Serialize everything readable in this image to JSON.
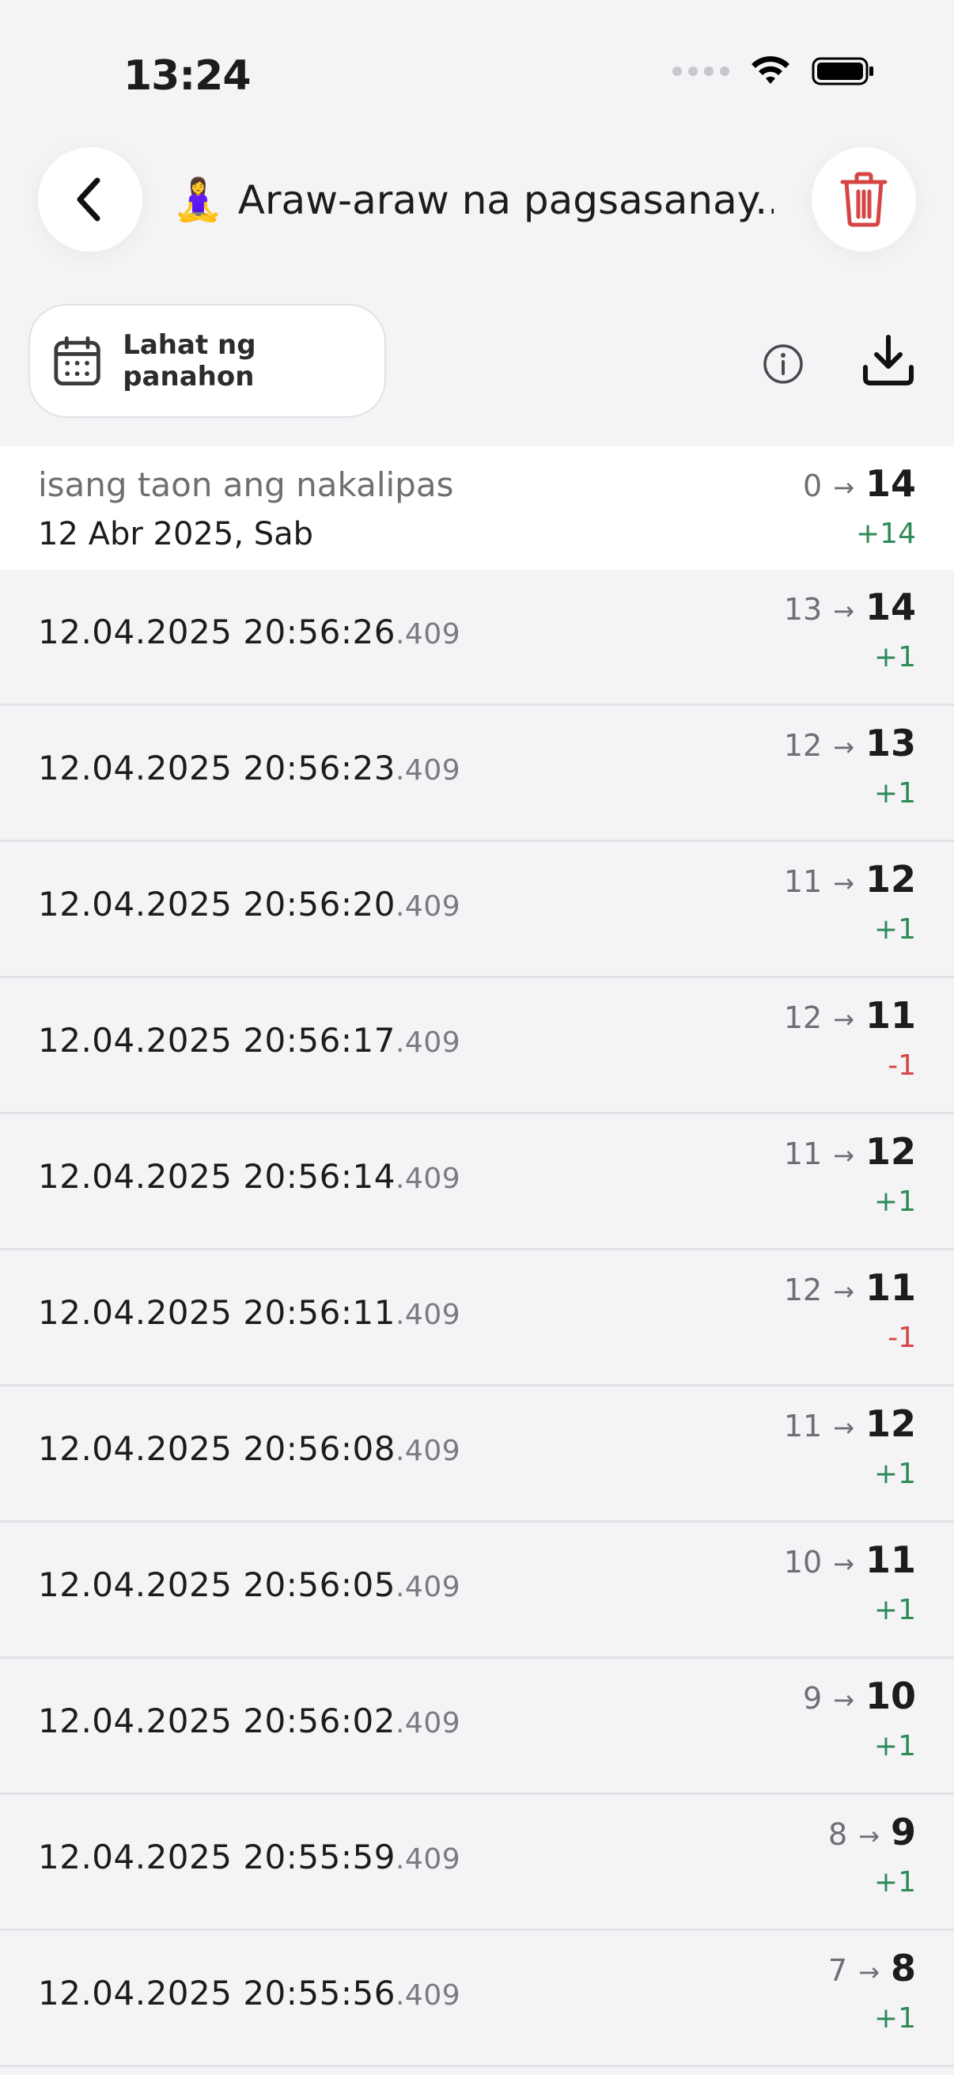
{
  "status_bar": {
    "time": "13:24"
  },
  "header": {
    "title_emoji": "🧘‍♀️",
    "title": "Araw-araw na pagsasanay..."
  },
  "toolbar": {
    "period_label": "Lahat ng panahon"
  },
  "group": {
    "relative": "isang taon ang nakalipas",
    "date": "12 Abr 2025, Sab",
    "from": "0",
    "to": "14",
    "delta": "+14"
  },
  "entries": [
    {
      "ts": "12.04.2025 20:56:26",
      "ms": ".409",
      "from": "13",
      "to": "14",
      "delta": "+1"
    },
    {
      "ts": "12.04.2025 20:56:23",
      "ms": ".409",
      "from": "12",
      "to": "13",
      "delta": "+1"
    },
    {
      "ts": "12.04.2025 20:56:20",
      "ms": ".409",
      "from": "11",
      "to": "12",
      "delta": "+1"
    },
    {
      "ts": "12.04.2025 20:56:17",
      "ms": ".409",
      "from": "12",
      "to": "11",
      "delta": "-1"
    },
    {
      "ts": "12.04.2025 20:56:14",
      "ms": ".409",
      "from": "11",
      "to": "12",
      "delta": "+1"
    },
    {
      "ts": "12.04.2025 20:56:11",
      "ms": ".409",
      "from": "12",
      "to": "11",
      "delta": "-1"
    },
    {
      "ts": "12.04.2025 20:56:08",
      "ms": ".409",
      "from": "11",
      "to": "12",
      "delta": "+1"
    },
    {
      "ts": "12.04.2025 20:56:05",
      "ms": ".409",
      "from": "10",
      "to": "11",
      "delta": "+1"
    },
    {
      "ts": "12.04.2025 20:56:02",
      "ms": ".409",
      "from": "9",
      "to": "10",
      "delta": "+1"
    },
    {
      "ts": "12.04.2025 20:55:59",
      "ms": ".409",
      "from": "8",
      "to": "9",
      "delta": "+1"
    },
    {
      "ts": "12.04.2025 20:55:56",
      "ms": ".409",
      "from": "7",
      "to": "8",
      "delta": "+1"
    }
  ],
  "icons": {
    "back": "chevron-left-icon",
    "trash": "trash-icon",
    "calendar": "calendar-icon",
    "info": "info-icon",
    "download": "download-icon"
  },
  "colors": {
    "positive": "#2e8b57",
    "negative": "#d64545",
    "trash": "#d64545"
  }
}
